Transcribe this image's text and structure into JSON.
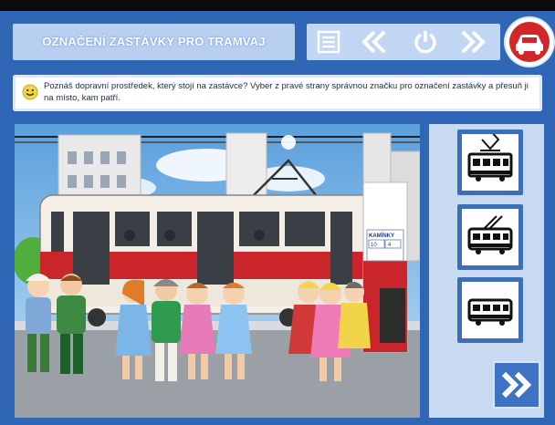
{
  "header": {
    "title": "OZNAČENÍ ZASTÁVKY PRO TRAMVAJ"
  },
  "toolbar": {
    "icons": [
      "menu-icon",
      "back-double-chevron-icon",
      "restart-icon",
      "forward-double-chevron-icon"
    ]
  },
  "car_button": {
    "icon": "car-icon"
  },
  "instruction": {
    "icon": "smiley-icon",
    "text": "Poznáš dopravní prostředek, který stojí na zastávce? Vyber z pravé strany správnou značku pro označení zastávky a přesuň ji na místo, kam patří."
  },
  "scene": {
    "stop_board": {
      "title": "KAMÍNKY",
      "line_numbers": [
        "10",
        "4"
      ]
    }
  },
  "signs": [
    {
      "icon": "tram-sign-icon"
    },
    {
      "icon": "trolleybus-sign-icon"
    },
    {
      "icon": "bus-sign-icon"
    }
  ],
  "next": {
    "icon": "next-double-chevron-icon"
  },
  "colors": {
    "background": "#2f66b5",
    "panel": "#c1d6f2",
    "tram_red": "#c9252b",
    "car_button": "#d2262b"
  }
}
